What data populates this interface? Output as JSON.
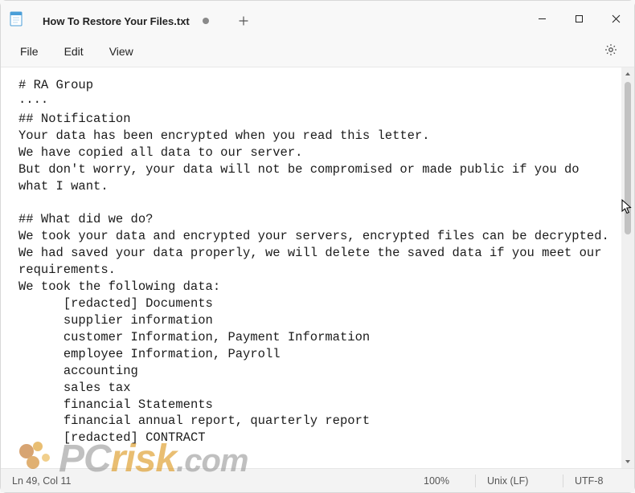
{
  "titlebar": {
    "tab_title": "How To Restore Your Files.txt",
    "unsaved": true
  },
  "menus": {
    "file": "File",
    "edit": "Edit",
    "view": "View"
  },
  "document": {
    "text": "# RA Group\n····\n## Notification\nYour data has been encrypted when you read this letter.\nWe have copied all data to our server.\nBut don't worry, your data will not be compromised or made public if you do what I want.\n\n## What did we do?\nWe took your data and encrypted your servers, encrypted files can be decrypted.\nWe had saved your data properly, we will delete the saved data if you meet our requirements.\nWe took the following data:\n      [redacted] Documents\n      supplier information\n      customer Information, Payment Information\n      employee Information, Payroll\n      accounting\n      sales tax\n      financial Statements\n      financial annual report, quarterly report\n      [redacted] CONTRACT"
  },
  "statusbar": {
    "position": "Ln 49, Col 11",
    "zoom": "100%",
    "line_ending": "Unix (LF)",
    "encoding": "UTF-8"
  },
  "watermark": {
    "pc": "PC",
    "risk": "risk",
    "com": ".com"
  }
}
